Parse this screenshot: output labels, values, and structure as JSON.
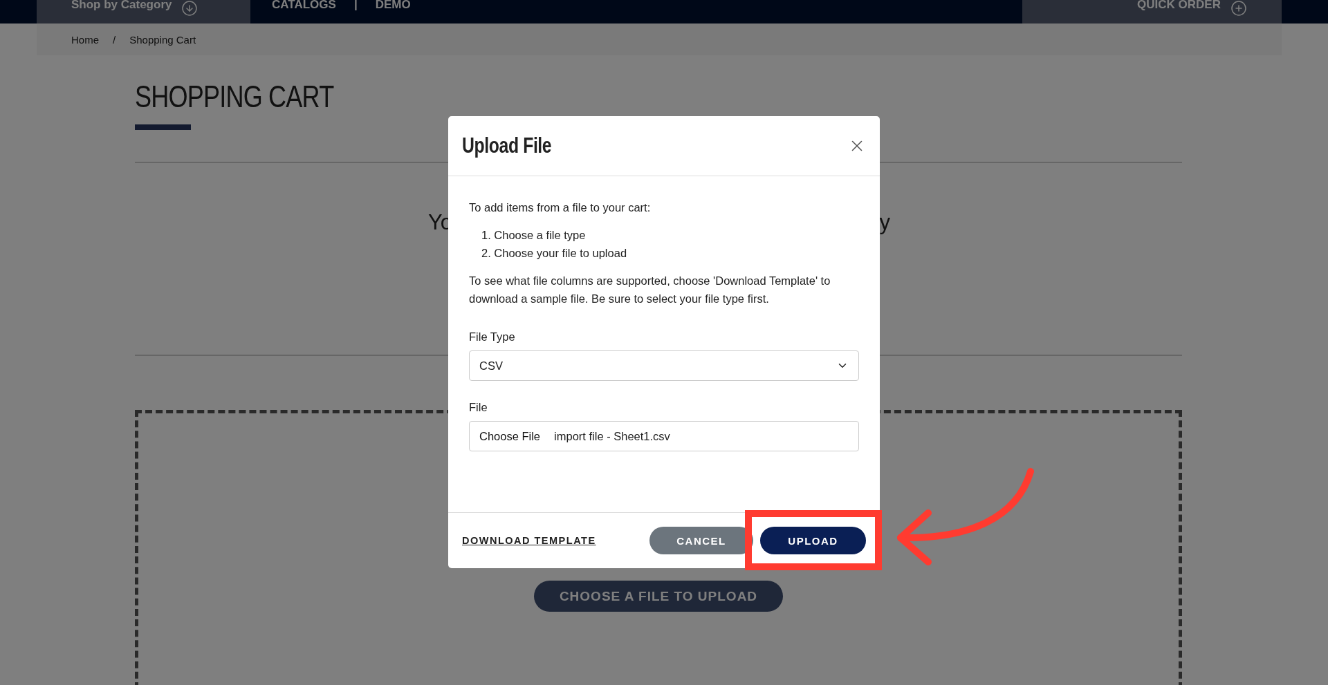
{
  "nav": {
    "category_button": "Shop by Category",
    "links": [
      "CATALOGS",
      "DEMO"
    ],
    "separator": "|",
    "quick_order": "QUICK ORDER"
  },
  "breadcrumb": {
    "separator": "/",
    "items": [
      {
        "label": "Home"
      },
      {
        "label": "Shopping Cart"
      }
    ]
  },
  "page": {
    "title": "SHOPPING CART",
    "empty_message_start": "Yo",
    "empty_message_end": "y",
    "upload_button": "CHOOSE A FILE TO UPLOAD"
  },
  "modal": {
    "title": "Upload File",
    "intro": "To add items from a file to your cart:",
    "steps": [
      "1. Choose a file type",
      "2. Choose your file to upload"
    ],
    "note": "To see what file columns are supported, choose 'Download Template' to download a sample file. Be sure to select your file type first.",
    "fields": [
      {
        "kind": "select",
        "label": "File Type",
        "value": "CSV"
      },
      {
        "kind": "file",
        "label": "File",
        "button": "Choose File",
        "value": "import file - Sheet1.csv"
      }
    ],
    "footer": {
      "link": "DOWNLOAD TEMPLATE",
      "buttons": [
        {
          "label": "CANCEL",
          "kind": "secondary"
        },
        {
          "label": "UPLOAD",
          "kind": "primary"
        }
      ]
    }
  }
}
